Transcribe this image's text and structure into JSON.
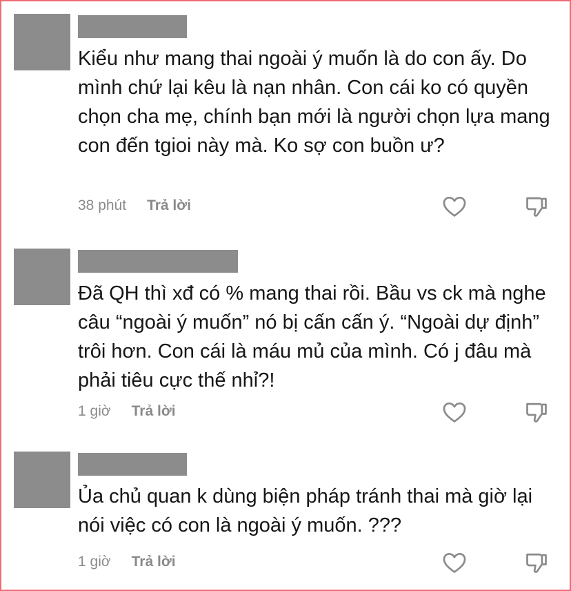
{
  "comments": [
    {
      "text": "Kiểu như mang thai ngoài ý muốn là do con ấy. Do mình chứ lại kêu là nạn nhân. Con cái ko có quyền chọn cha mẹ, chính bạn mới là người chọn lựa mang con đến tgioi này mà. Ko sợ con buồn ư?",
      "time": "38 phút",
      "reply_label": "Trả lời"
    },
    {
      "text": "Đã QH thì xđ có % mang thai rồi. Bầu vs ck mà nghe câu “ngoài ý muốn” nó bị cấn cấn ý. “Ngoài dự định” trôi hơn. Con cái là máu mủ của mình. Có j đâu mà phải tiêu cực thế nhỉ?!",
      "time": "1 giờ",
      "reply_label": "Trả lời"
    },
    {
      "text": "Ủa chủ quan k dùng biện pháp tránh thai mà giờ lại nói việc có con là ngoài ý muốn. ???",
      "time": "1 giờ",
      "reply_label": "Trả lời"
    }
  ],
  "icons": {
    "like": "heart-icon",
    "dislike": "thumbs-down-icon"
  },
  "colors": {
    "border": "#f06b74",
    "placeholder": "#8c8c8c",
    "meta_text": "#8a8a8a"
  }
}
